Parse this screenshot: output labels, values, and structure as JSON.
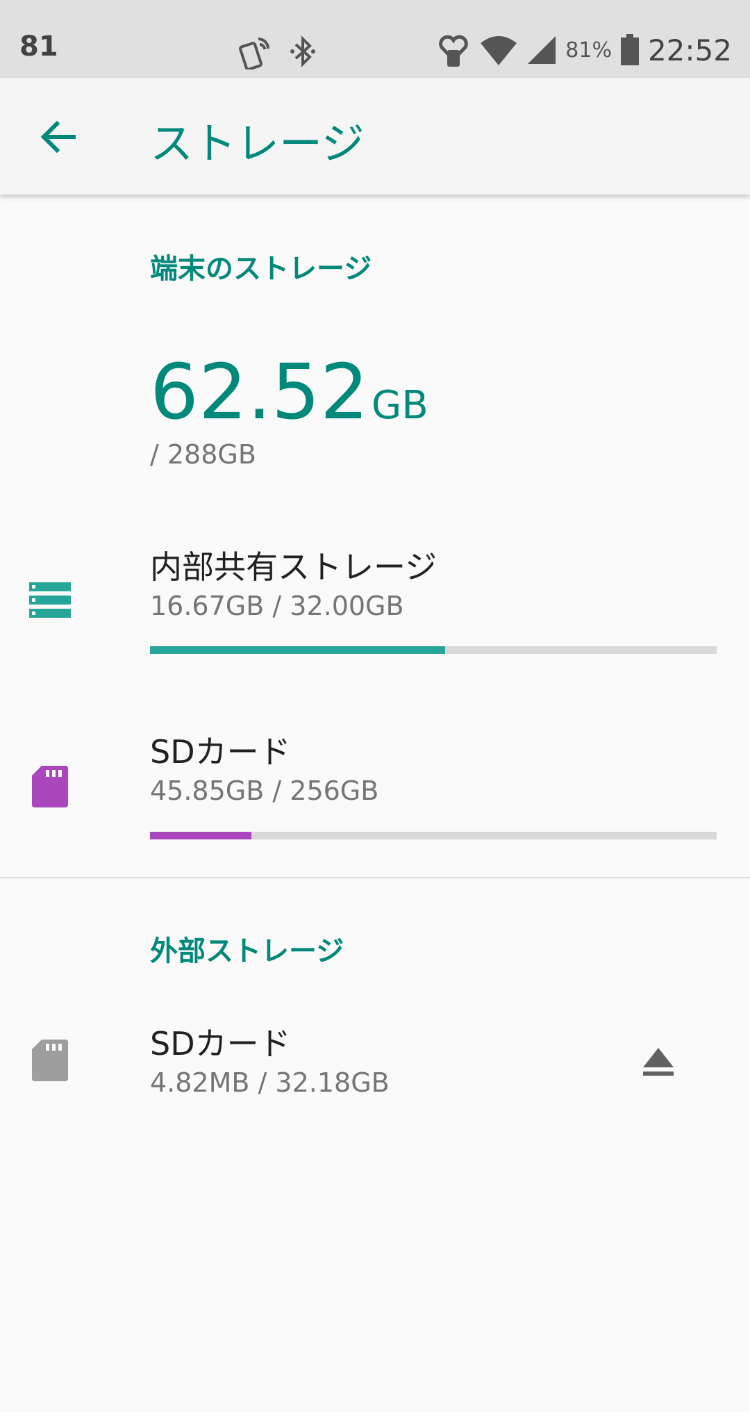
{
  "status_bar": {
    "left_text": "81",
    "battery_percent": "81%",
    "time": "22:52",
    "icons": [
      "nfc-icon",
      "bluetooth-icon",
      "heart-monitor-icon",
      "wifi-icon",
      "cell-signal-icon",
      "battery-icon"
    ]
  },
  "app_bar": {
    "title": "ストレージ"
  },
  "device_storage": {
    "header": "端末のストレージ",
    "used_value": "62.52",
    "used_unit": "GB",
    "total_label": "/ 288GB",
    "items": [
      {
        "name": "内部共有ストレージ",
        "usage": "16.67GB / 32.00GB",
        "fraction": 0.521,
        "color": "#26a69a",
        "icon": "storage-icon"
      },
      {
        "name": "SDカード",
        "usage": "45.85GB / 256GB",
        "fraction": 0.179,
        "color": "#ab47bc",
        "icon": "sd-card-icon"
      }
    ]
  },
  "external_storage": {
    "header": "外部ストレージ",
    "items": [
      {
        "name": "SDカード",
        "usage": "4.82MB / 32.18GB",
        "icon": "sd-card-icon",
        "action_icon": "eject-icon"
      }
    ]
  },
  "colors": {
    "accent": "#00897b",
    "internal_bar": "#26a69a",
    "sd_bar": "#ab47bc",
    "track": "#d9d9d9"
  }
}
